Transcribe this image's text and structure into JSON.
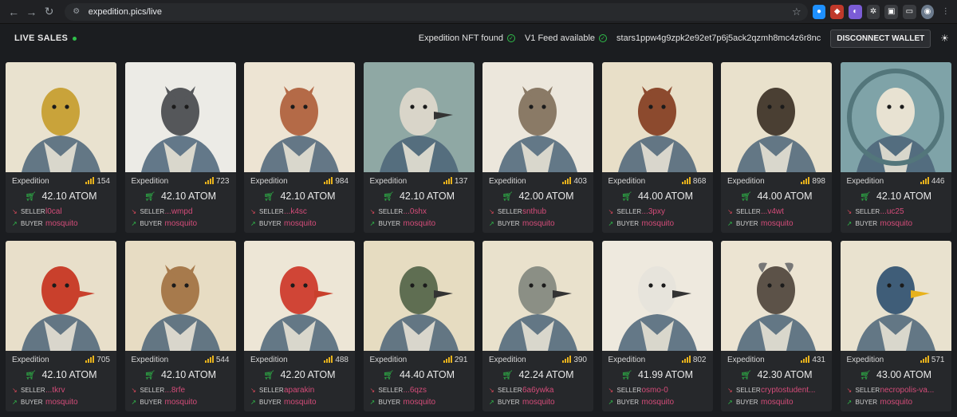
{
  "browser": {
    "url": "expedition.pics/live"
  },
  "header": {
    "title": "LIVE SALES",
    "nft_status": "Expedition NFT found",
    "feed_status": "V1 Feed available",
    "wallet": "stars1ppw4g9zpk2e92et7p6j5ack2qzmh8mc4z6r8nc",
    "disconnect_label": "DISCONNECT WALLET"
  },
  "labels": {
    "seller": "SELLER",
    "buyer": "BUYER"
  },
  "cards": [
    {
      "collection": "Expedition",
      "rank": "154",
      "price": "42.10 ATOM",
      "seller": "l0cal",
      "buyer": "mosquito",
      "animal": "rodent",
      "bg": "#e9e2cf",
      "fg": "#c9a33a"
    },
    {
      "collection": "Expedition",
      "rank": "723",
      "price": "42.10 ATOM",
      "seller": "...wmpd",
      "buyer": "mosquito",
      "animal": "schnauzer",
      "bg": "#ecebe6",
      "fg": "#55575a"
    },
    {
      "collection": "Expedition",
      "rank": "984",
      "price": "42.10 ATOM",
      "seller": "...k4sc",
      "buyer": "mosquito",
      "animal": "dog",
      "bg": "#ede4d3",
      "fg": "#b46a47"
    },
    {
      "collection": "Expedition",
      "rank": "137",
      "price": "42.10 ATOM",
      "seller": "...0shx",
      "buyer": "mosquito",
      "animal": "dove",
      "bg": "#8fa8a4",
      "fg": "#d9d5c9"
    },
    {
      "collection": "Expedition",
      "rank": "403",
      "price": "42.00 ATOM",
      "seller": "snthub",
      "buyer": "mosquito",
      "animal": "deer",
      "bg": "#ece7dc",
      "fg": "#8a7a66"
    },
    {
      "collection": "Expedition",
      "rank": "868",
      "price": "44.00 ATOM",
      "seller": "...3pxy",
      "buyer": "mosquito",
      "animal": "dog",
      "bg": "#e8dfc8",
      "fg": "#8c4a2e"
    },
    {
      "collection": "Expedition",
      "rank": "898",
      "price": "44.00 ATOM",
      "seller": "...v4wt",
      "buyer": "mosquito",
      "animal": "terrier",
      "bg": "#e9e1cc",
      "fg": "#4a3f33"
    },
    {
      "collection": "Expedition",
      "rank": "446",
      "price": "42.10 ATOM",
      "seller": "...uc25",
      "buyer": "mosquito",
      "animal": "sheep",
      "bg": "#7fa3a8",
      "fg": "#e8e2d2"
    },
    {
      "collection": "Expedition",
      "rank": "705",
      "price": "42.10 ATOM",
      "seller": "...tkrv",
      "buyer": "mosquito",
      "animal": "duck",
      "bg": "#e8dfca",
      "fg": "#c9402c"
    },
    {
      "collection": "Expedition",
      "rank": "544",
      "price": "42.10 ATOM",
      "seller": "...8rfe",
      "buyer": "mosquito",
      "animal": "hound",
      "bg": "#e7dcc3",
      "fg": "#a77a4c"
    },
    {
      "collection": "Expedition",
      "rank": "488",
      "price": "42.20 ATOM",
      "seller": "aparakin",
      "buyer": "mosquito",
      "animal": "crane",
      "bg": "#ede6d6",
      "fg": "#d04536"
    },
    {
      "collection": "Expedition",
      "rank": "291",
      "price": "44.40 ATOM",
      "seller": "...6qzs",
      "buyer": "mosquito",
      "animal": "bird",
      "bg": "#e6dcc1",
      "fg": "#5f6e52"
    },
    {
      "collection": "Expedition",
      "rank": "390",
      "price": "42.24 ATOM",
      "seller": "6a6ywka",
      "buyer": "mosquito",
      "animal": "heron",
      "bg": "#e9e1cc",
      "fg": "#8b8f85"
    },
    {
      "collection": "Expedition",
      "rank": "802",
      "price": "41.99 ATOM",
      "seller": "osmo-0",
      "buyer": "mosquito",
      "animal": "goose",
      "bg": "#eee9de",
      "fg": "#e7e4dc"
    },
    {
      "collection": "Expedition",
      "rank": "431",
      "price": "42.30 ATOM",
      "seller": "cryptostudent...",
      "buyer": "mosquito",
      "animal": "goat",
      "bg": "#ece4d2",
      "fg": "#5c5248"
    },
    {
      "collection": "Expedition",
      "rank": "571",
      "price": "43.00 ATOM",
      "seller": "necropolis-va...",
      "buyer": "mosquito",
      "animal": "eagle",
      "bg": "#e9e2cf",
      "fg": "#3f5d78"
    }
  ]
}
